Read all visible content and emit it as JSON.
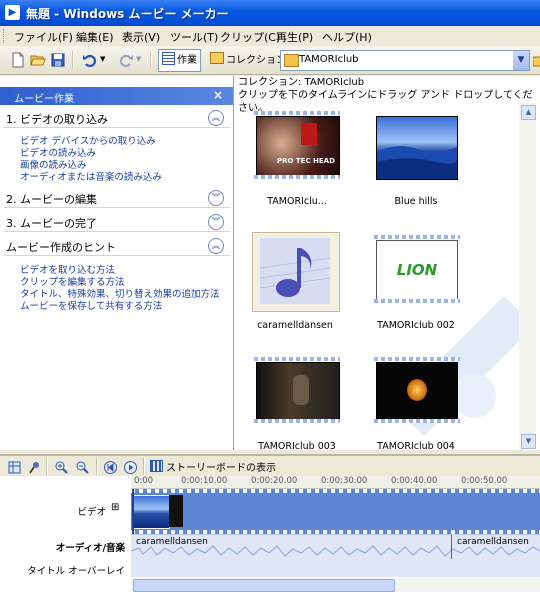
{
  "window": {
    "title": "無題 - Windows ムービー メーカー",
    "app_icon": "movie-maker-icon"
  },
  "menu": [
    "ファイル(F)",
    "編集(E)",
    "表示(V)",
    "ツール(T)",
    "クリップ(C)",
    "再生(P)",
    "ヘルプ(H)"
  ],
  "toolbar": {
    "tasks_label": "作業",
    "collection_label": "コレクション",
    "collection_combo_value": "TAMORIclub"
  },
  "tasks_pane": {
    "title": "ムービー作業",
    "close": "×",
    "sections": [
      {
        "title": "1. ビデオの取り込み",
        "links": [
          "ビデオ デバイスからの取り込み",
          "ビデオの読み込み",
          "画像の読み込み",
          "オーディオまたは音楽の読み込み"
        ]
      },
      {
        "title": "2. ムービーの編集",
        "links": []
      },
      {
        "title": "3. ムービーの完了",
        "links": []
      },
      {
        "title": "ムービー作成のヒント",
        "links": [
          "ビデオを取り込む方法",
          "クリップを編集する方法",
          "タイトル、特殊効果、切り替え効果の追加方法",
          "ムービーを保存して共有する方法"
        ]
      }
    ]
  },
  "collection": {
    "header": "コレクション: TAMORIclub",
    "instruction": "クリップを下のタイムラインにドラッグ アンド ドロップしてください。",
    "items": [
      {
        "label": "TAMORIclu...",
        "thumb_text": "PRO TEC HEAD"
      },
      {
        "label": "Blue hills",
        "thumb_text": ""
      },
      {
        "label": "caramelldansen",
        "thumb_text": ""
      },
      {
        "label": "TAMORIclub 002",
        "thumb_text": "LION"
      },
      {
        "label": "TAMORIclub 003",
        "thumb_text": ""
      },
      {
        "label": "TAMORIclub 004",
        "thumb_text": ""
      }
    ]
  },
  "timeline": {
    "storyboard_label": "ストーリーボードの表示",
    "ruler": [
      "0:00",
      "0:00:10.00",
      "0:00:20.00",
      "0:00:30.00",
      "0:00:40.00",
      "0:00:50.00"
    ],
    "tracks": {
      "video": "ビデオ",
      "expand": "⊞",
      "audio": "オーディオ/音楽",
      "title_overlay": "タイトル オーバーレイ"
    },
    "audio_clips": [
      "caramelldansen",
      "caramelldansen"
    ]
  }
}
